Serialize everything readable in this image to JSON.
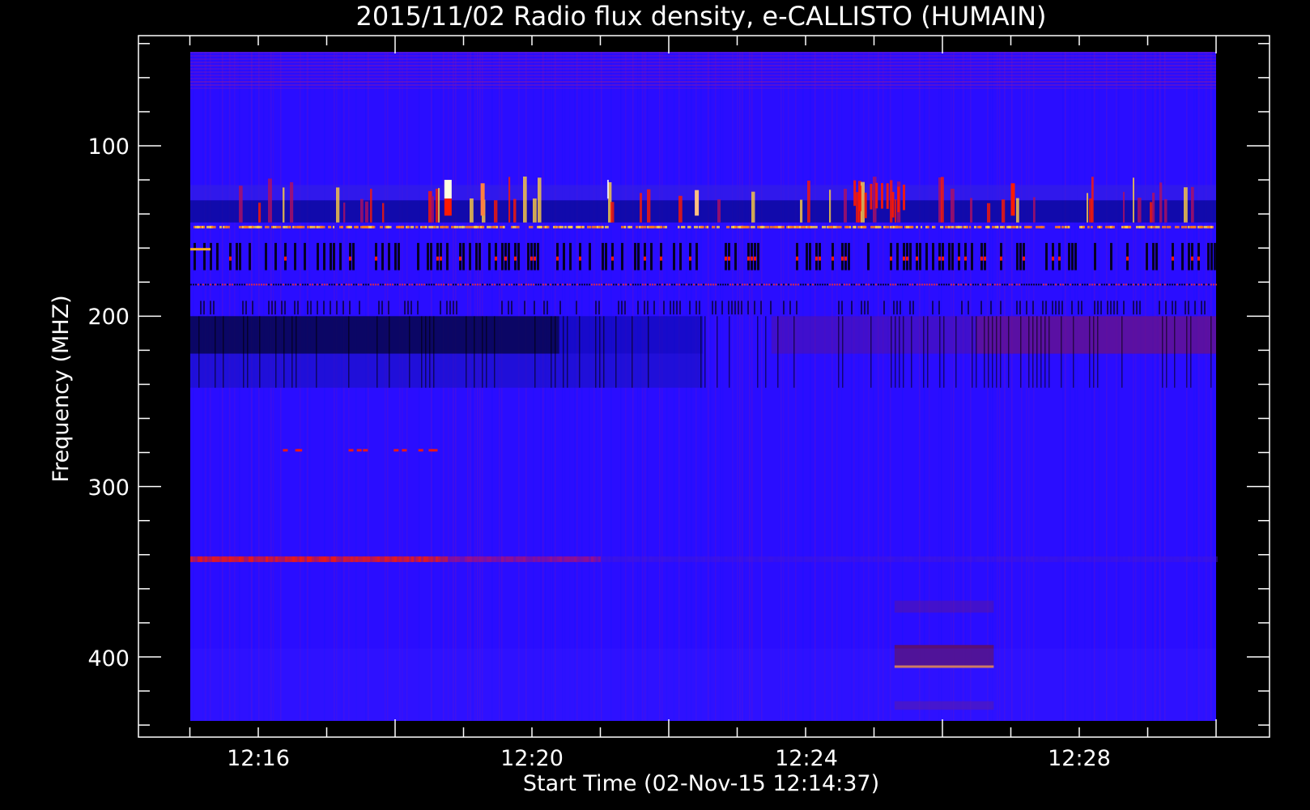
{
  "chart_data": {
    "type": "heatmap",
    "title": "2015/11/02  Radio flux density, e-CALLISTO (HUMAIN)",
    "xlabel": "Start Time (02-Nov-15 12:14:37)",
    "ylabel": "Frequency (MHZ)",
    "x_start_minutes": 0,
    "x_tick_labels": [
      "12:16",
      "12:20",
      "12:24",
      "12:28"
    ],
    "y_tick_labels": [
      "100",
      "200",
      "300",
      "400"
    ],
    "y_tick_values": [
      100,
      200,
      300,
      400
    ],
    "y_inverted": true,
    "background_color": "#000000",
    "colors": {
      "baseline": "#2a0dff",
      "low": "#000000",
      "mid": "#ff1a00",
      "high": "#ffd040",
      "peak": "#ffffe0",
      "axis": "#ffffff"
    }
  }
}
